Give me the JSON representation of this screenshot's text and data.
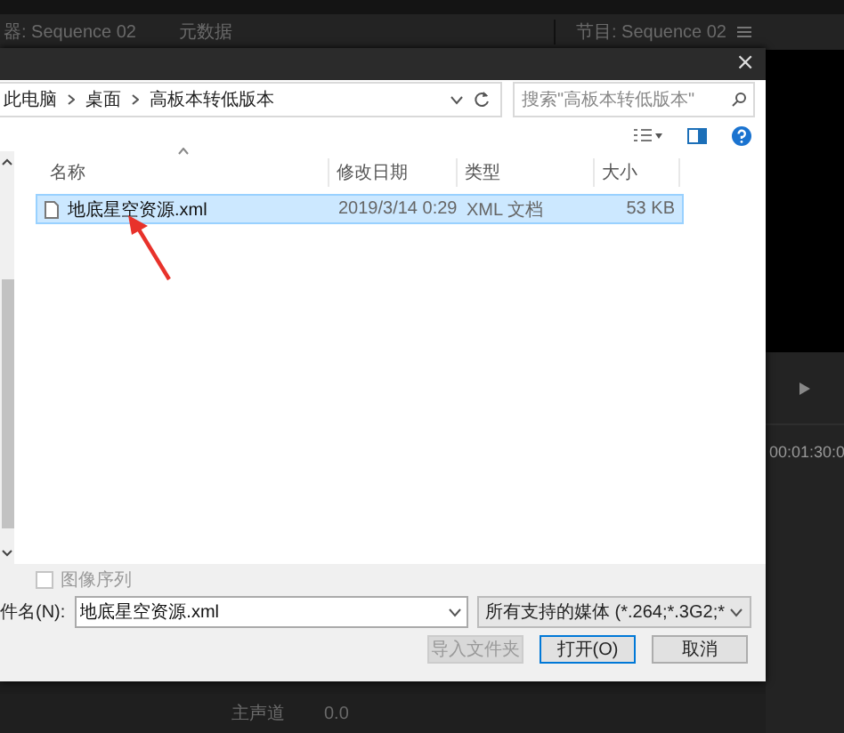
{
  "background": {
    "panel_tabs": [
      {
        "label": "器: Sequence 02"
      },
      {
        "label": "元数据"
      },
      {
        "label": "节目: Sequence 02"
      }
    ],
    "timecode": "00:01:30:0",
    "track_label": "主声道",
    "track_value": "0.0"
  },
  "dialog": {
    "close": "×",
    "breadcrumb": [
      "此电脑",
      "桌面",
      "高板本转低版本"
    ],
    "search": {
      "placeholder": "搜索\"高板本转低版本\""
    },
    "columns": [
      "名称",
      "修改日期",
      "类型",
      "大小"
    ],
    "files": [
      {
        "name": "地底星空资源.xml",
        "modified": "2019/3/14 0:29",
        "type": "XML 文档",
        "size": "53 KB",
        "selected": true
      }
    ],
    "image_sequence": {
      "label": "图像序列",
      "checked": false,
      "disabled": true
    },
    "filename_label": "件名(N):",
    "filename": "地底星空资源.xml",
    "filter": "所有支持的媒体 (*.264;*.3G2;*",
    "buttons": [
      {
        "label": "导入文件夹",
        "disabled": true,
        "default": false
      },
      {
        "label": "打开(O)",
        "disabled": false,
        "default": true
      },
      {
        "label": "取消",
        "disabled": false,
        "default": false
      }
    ]
  }
}
